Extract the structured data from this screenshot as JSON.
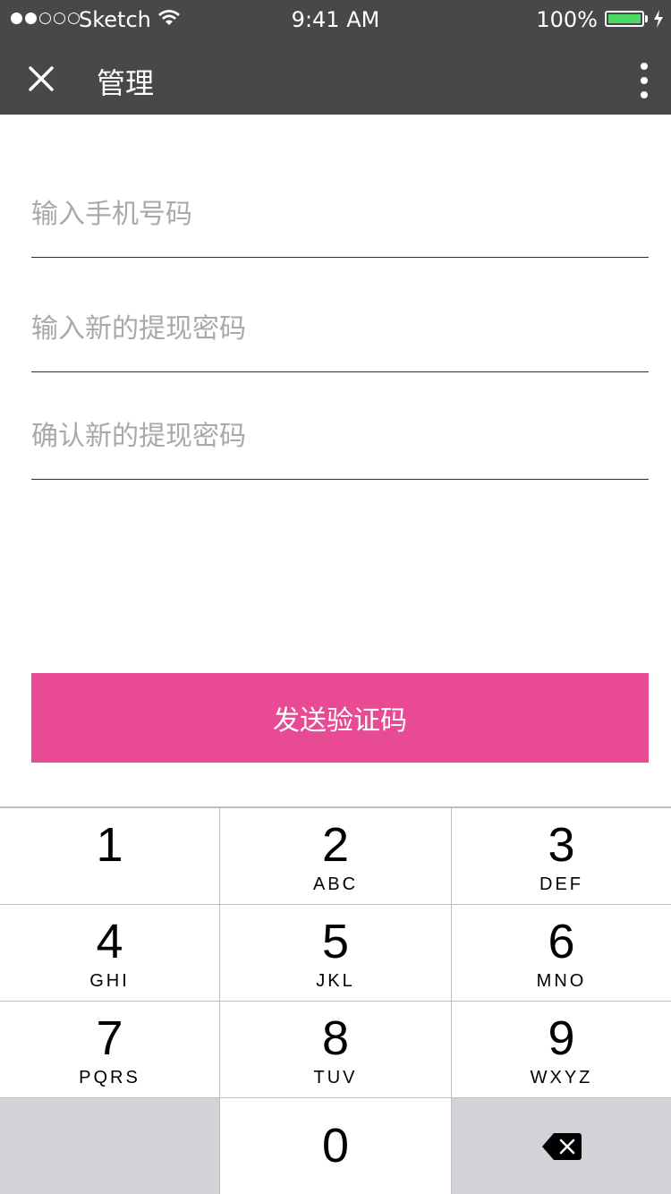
{
  "status_bar": {
    "carrier": "Sketch",
    "time": "9:41 AM",
    "battery": "100%"
  },
  "nav": {
    "title": "管理",
    "close_icon": "close-icon",
    "more_icon": "more-vertical-icon"
  },
  "form": {
    "phone_placeholder": "输入手机号码",
    "new_password_placeholder": "输入新的提现密码",
    "confirm_password_placeholder": "确认新的提现密码"
  },
  "send_button": {
    "label": "发送验证码",
    "color": "#e84a93"
  },
  "keypad": {
    "keys": [
      {
        "num": "1",
        "letters": ""
      },
      {
        "num": "2",
        "letters": "ABC"
      },
      {
        "num": "3",
        "letters": "DEF"
      },
      {
        "num": "4",
        "letters": "GHI"
      },
      {
        "num": "5",
        "letters": "JKL"
      },
      {
        "num": "6",
        "letters": "MNO"
      },
      {
        "num": "7",
        "letters": "PQRS"
      },
      {
        "num": "8",
        "letters": "TUV"
      },
      {
        "num": "9",
        "letters": "WXYZ"
      },
      {
        "num": "0",
        "letters": ""
      }
    ],
    "backspace_icon": "backspace-icon"
  }
}
